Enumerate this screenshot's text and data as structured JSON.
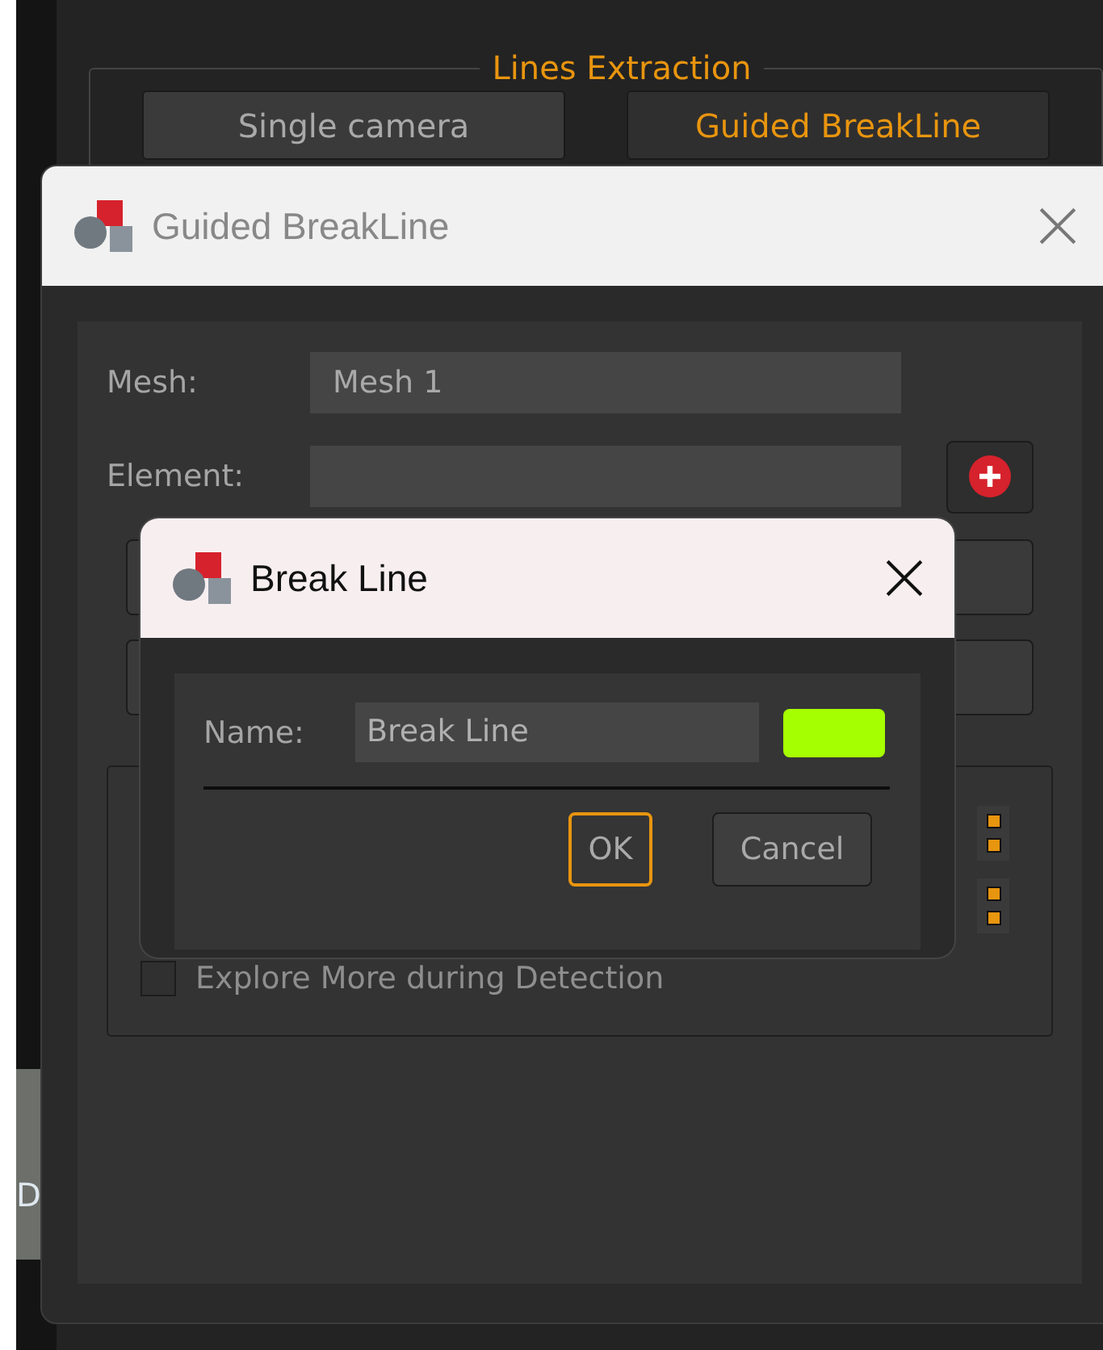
{
  "background_panel": {
    "group_title": "Lines Extraction",
    "buttons": [
      {
        "label": "Single camera",
        "selected": false
      },
      {
        "label": "Guided BreakLine",
        "selected": true
      }
    ]
  },
  "side_strip": {
    "letter": "D"
  },
  "guided_dialog": {
    "title": "Guided BreakLine",
    "mesh_label": "Mesh:",
    "mesh_value": "Mesh 1",
    "element_label": "Element:",
    "explore_checkbox": {
      "label": "Explore More during Detection",
      "checked": false
    }
  },
  "break_line_dialog": {
    "title": "Break Line",
    "name_label": "Name:",
    "name_value": "Break Line",
    "color": "#a6ff00",
    "buttons": [
      {
        "label": "OK",
        "kind": "default"
      },
      {
        "label": "Cancel",
        "kind": "normal"
      }
    ]
  }
}
